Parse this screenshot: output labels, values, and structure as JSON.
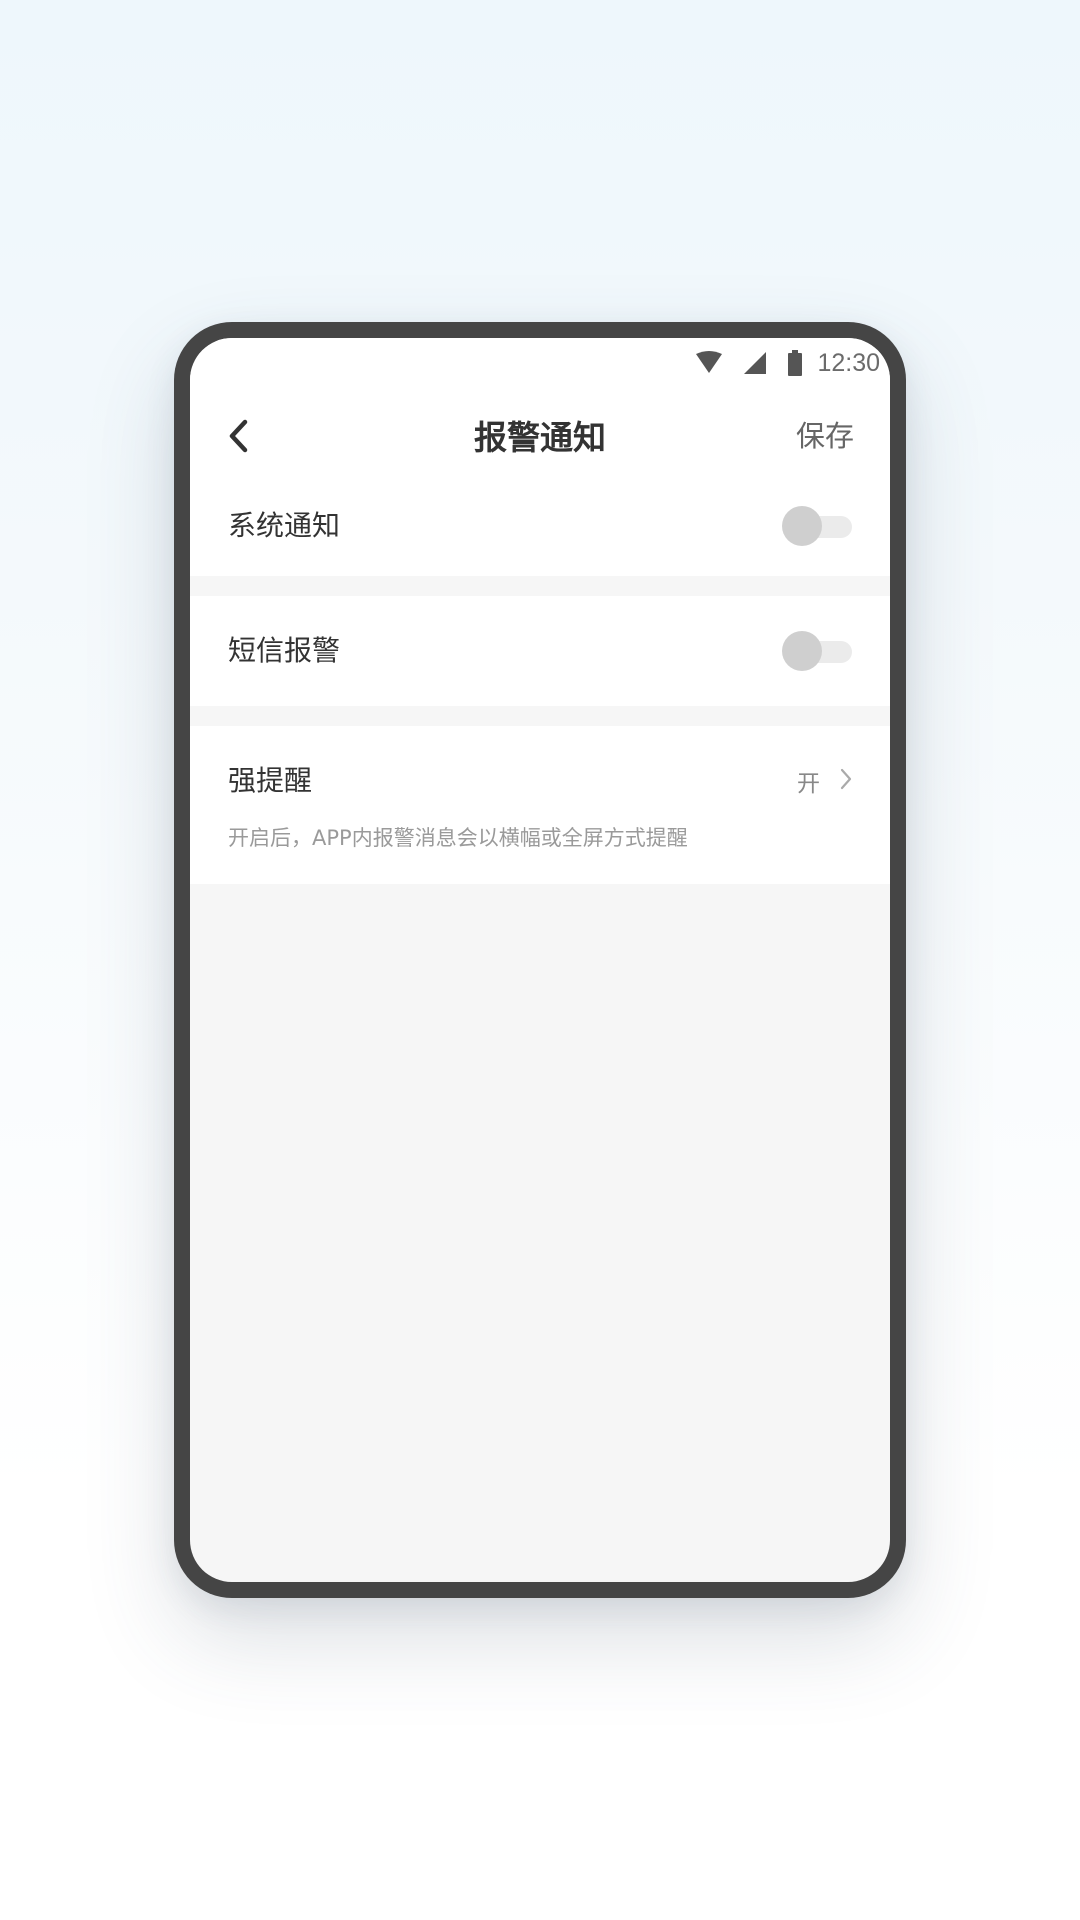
{
  "status_bar": {
    "time": "12:30",
    "icons": [
      "wifi-icon",
      "cellular-signal-icon",
      "battery-icon"
    ]
  },
  "nav": {
    "back_icon": "chevron-left-icon",
    "title": "报警通知",
    "save_label": "保存"
  },
  "settings": {
    "system_notice": {
      "label": "系统通知",
      "enabled": false
    },
    "sms_alarm": {
      "label": "短信报警",
      "enabled": false
    },
    "strong_reminder": {
      "label": "强提醒",
      "value": "开",
      "description": "开启后，APP内报警消息会以横幅或全屏方式提醒",
      "chevron_icon": "chevron-right-icon"
    }
  },
  "colors": {
    "frame": "#454545",
    "screen_background": "#f6f6f6",
    "toggle_off_knob": "#cfcfcf",
    "toggle_off_track": "#ebebeb"
  }
}
